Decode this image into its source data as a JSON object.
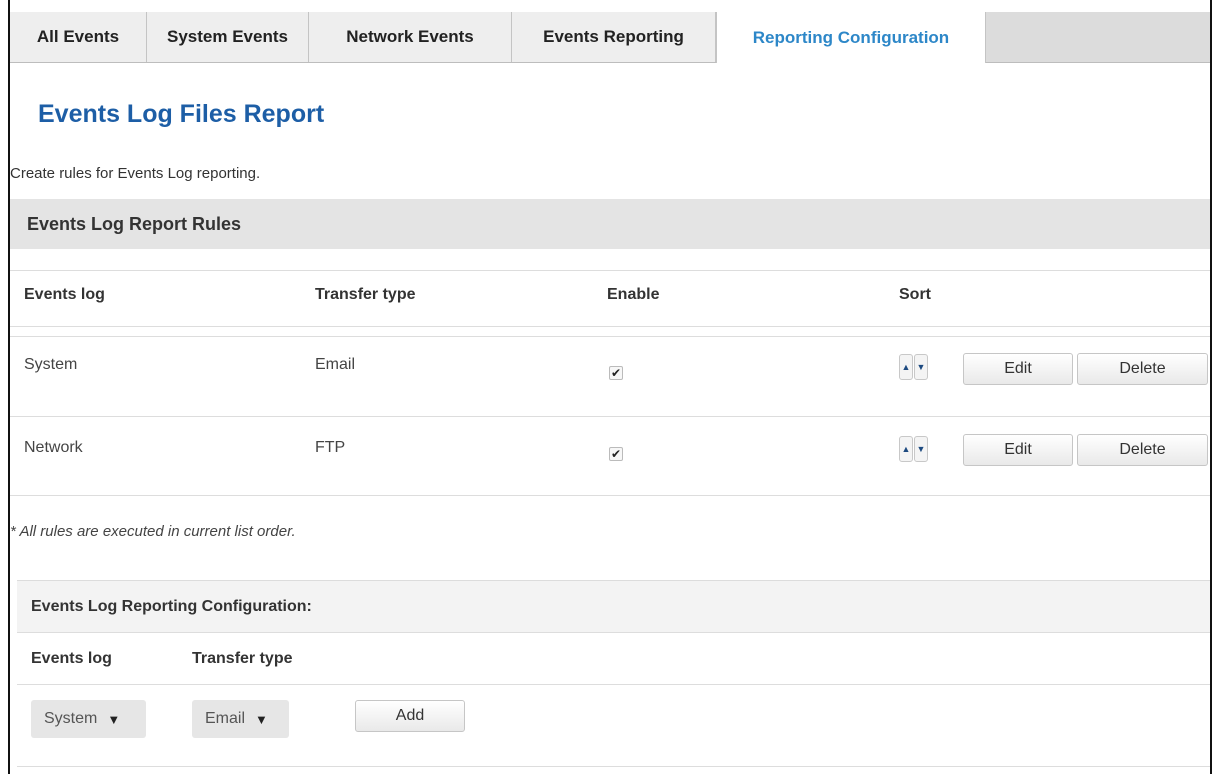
{
  "tabs": [
    {
      "label": "All Events",
      "active": false
    },
    {
      "label": "System Events",
      "active": false
    },
    {
      "label": "Network Events",
      "active": false
    },
    {
      "label": "Events Reporting",
      "active": false
    },
    {
      "label": "Reporting Configuration",
      "active": true
    }
  ],
  "page": {
    "title": "Events Log Files Report",
    "description": "Create rules for Events Log reporting."
  },
  "rules": {
    "section_title": "Events Log Report Rules",
    "columns": {
      "events_log": "Events log",
      "transfer_type": "Transfer type",
      "enable": "Enable",
      "sort": "Sort"
    },
    "rows": [
      {
        "events_log": "System",
        "transfer_type": "Email",
        "enabled": true,
        "edit_label": "Edit",
        "delete_label": "Delete"
      },
      {
        "events_log": "Network",
        "transfer_type": "FTP",
        "enabled": true,
        "edit_label": "Edit",
        "delete_label": "Delete"
      }
    ],
    "note": "* All rules are executed in current list order."
  },
  "config": {
    "title": "Events Log Reporting Configuration:",
    "columns": {
      "events_log": "Events log",
      "transfer_type": "Transfer type"
    },
    "events_log_value": "System",
    "transfer_type_value": "Email",
    "add_label": "Add"
  },
  "icons": {
    "sort_up": "sort-up-icon",
    "sort_down": "sort-down-icon",
    "check": "checkmark-icon",
    "dropdown": "caret-down-icon"
  },
  "colors": {
    "accent": "#2d87c8",
    "title": "#1d5ea6",
    "section_bg": "#e4e4e4"
  }
}
